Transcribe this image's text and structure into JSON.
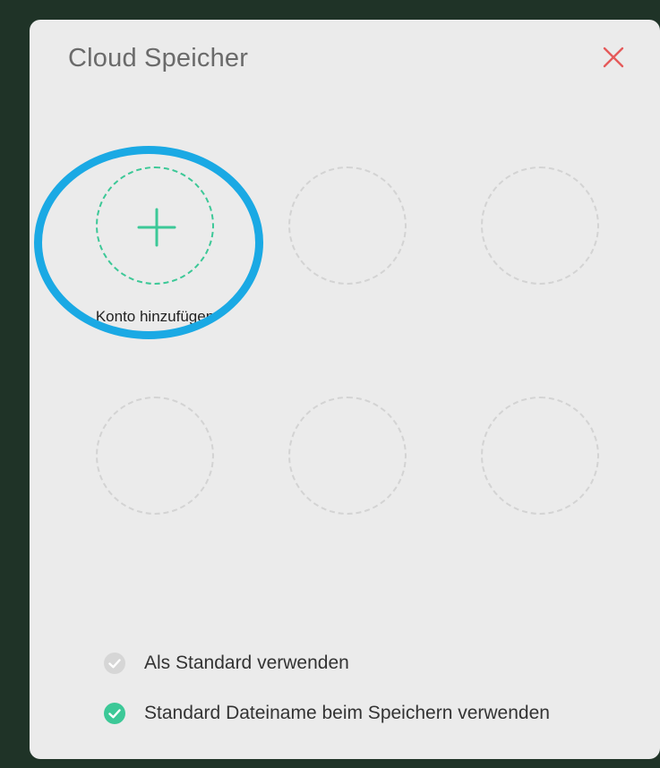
{
  "dialog": {
    "title": "Cloud Speicher",
    "close_icon": "close-icon"
  },
  "accounts": {
    "add_label": "Konto hinzufügen",
    "add_icon": "plus-icon",
    "empty_slots": 5
  },
  "options": [
    {
      "label": "Als Standard verwenden",
      "checked": false
    },
    {
      "label": "Standard Dateiname beim Speichern verwenden",
      "checked": true
    }
  ],
  "colors": {
    "accent": "#3cc897",
    "close": "#e55a5a",
    "highlight": "#1aa9e4",
    "unchecked": "#d6d6d6"
  }
}
